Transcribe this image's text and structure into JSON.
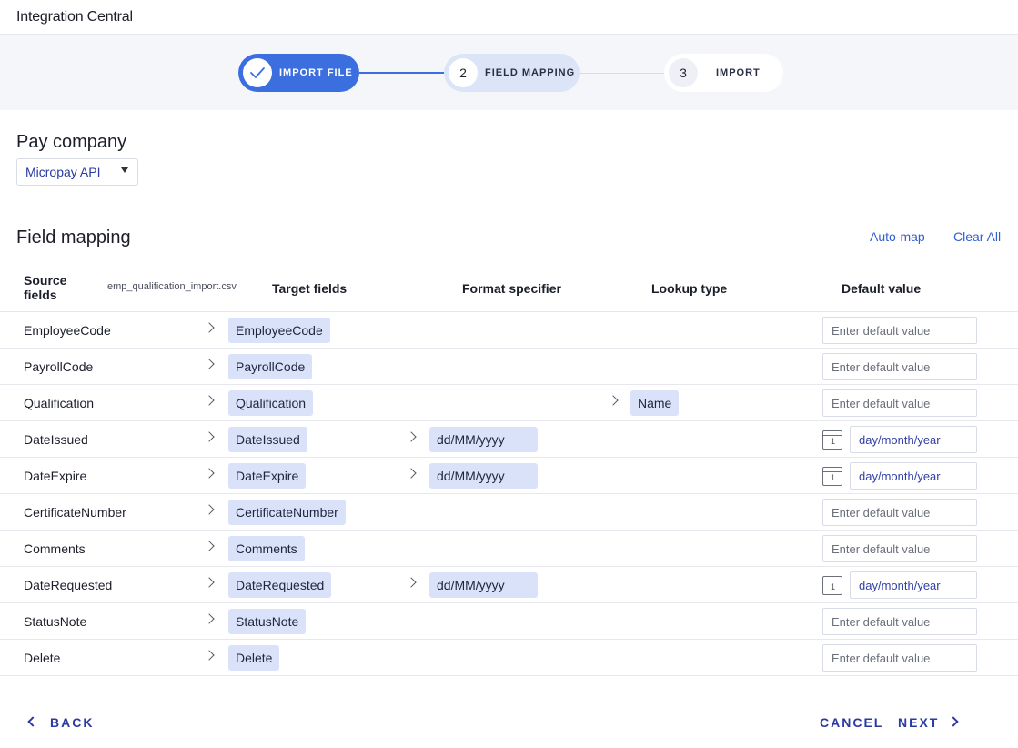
{
  "app": {
    "title": "Integration Central"
  },
  "stepper": {
    "steps": [
      {
        "number": "",
        "label": "IMPORT FILE",
        "state": "completed",
        "icon": "check-icon"
      },
      {
        "number": "2",
        "label": "FIELD MAPPING",
        "state": "active"
      },
      {
        "number": "3",
        "label": "IMPORT",
        "state": "pending"
      }
    ]
  },
  "pay_company": {
    "title": "Pay company",
    "selected": "Micropay API"
  },
  "field_mapping": {
    "title": "Field mapping",
    "auto_map_label": "Auto-map",
    "clear_all_label": "Clear All",
    "columns": {
      "source": "Source fields",
      "file": "emp_qualification_import.csv",
      "target": "Target fields",
      "format": "Format specifier",
      "lookup": "Lookup type",
      "default": "Default value"
    },
    "default_placeholder": "Enter default value",
    "date_placeholder": "day/month/year",
    "rows": [
      {
        "source": "EmployeeCode",
        "target": "EmployeeCode",
        "format": "",
        "lookup": "",
        "type": "text"
      },
      {
        "source": "PayrollCode",
        "target": "PayrollCode",
        "format": "",
        "lookup": "",
        "type": "text"
      },
      {
        "source": "Qualification",
        "target": "Qualification",
        "format": "",
        "lookup": "Name",
        "type": "text"
      },
      {
        "source": "DateIssued",
        "target": "DateIssued",
        "format": "dd/MM/yyyy",
        "lookup": "",
        "type": "date"
      },
      {
        "source": "DateExpire",
        "target": "DateExpire",
        "format": "dd/MM/yyyy",
        "lookup": "",
        "type": "date"
      },
      {
        "source": "CertificateNumber",
        "target": "CertificateNumber",
        "format": "",
        "lookup": "",
        "type": "text"
      },
      {
        "source": "Comments",
        "target": "Comments",
        "format": "",
        "lookup": "",
        "type": "text"
      },
      {
        "source": "DateRequested",
        "target": "DateRequested",
        "format": "dd/MM/yyyy",
        "lookup": "",
        "type": "date"
      },
      {
        "source": "StatusNote",
        "target": "StatusNote",
        "format": "",
        "lookup": "",
        "type": "text"
      },
      {
        "source": "Delete",
        "target": "Delete",
        "format": "",
        "lookup": "",
        "type": "text"
      }
    ]
  },
  "footer": {
    "back_label": "BACK",
    "cancel_label": "CANCEL",
    "next_label": "NEXT"
  },
  "colors": {
    "accent": "#3b6fe0",
    "chip": "#d9e2f8",
    "link": "#2f5fd0",
    "footer_text": "#2a3aa0"
  },
  "calendar_day": "1"
}
